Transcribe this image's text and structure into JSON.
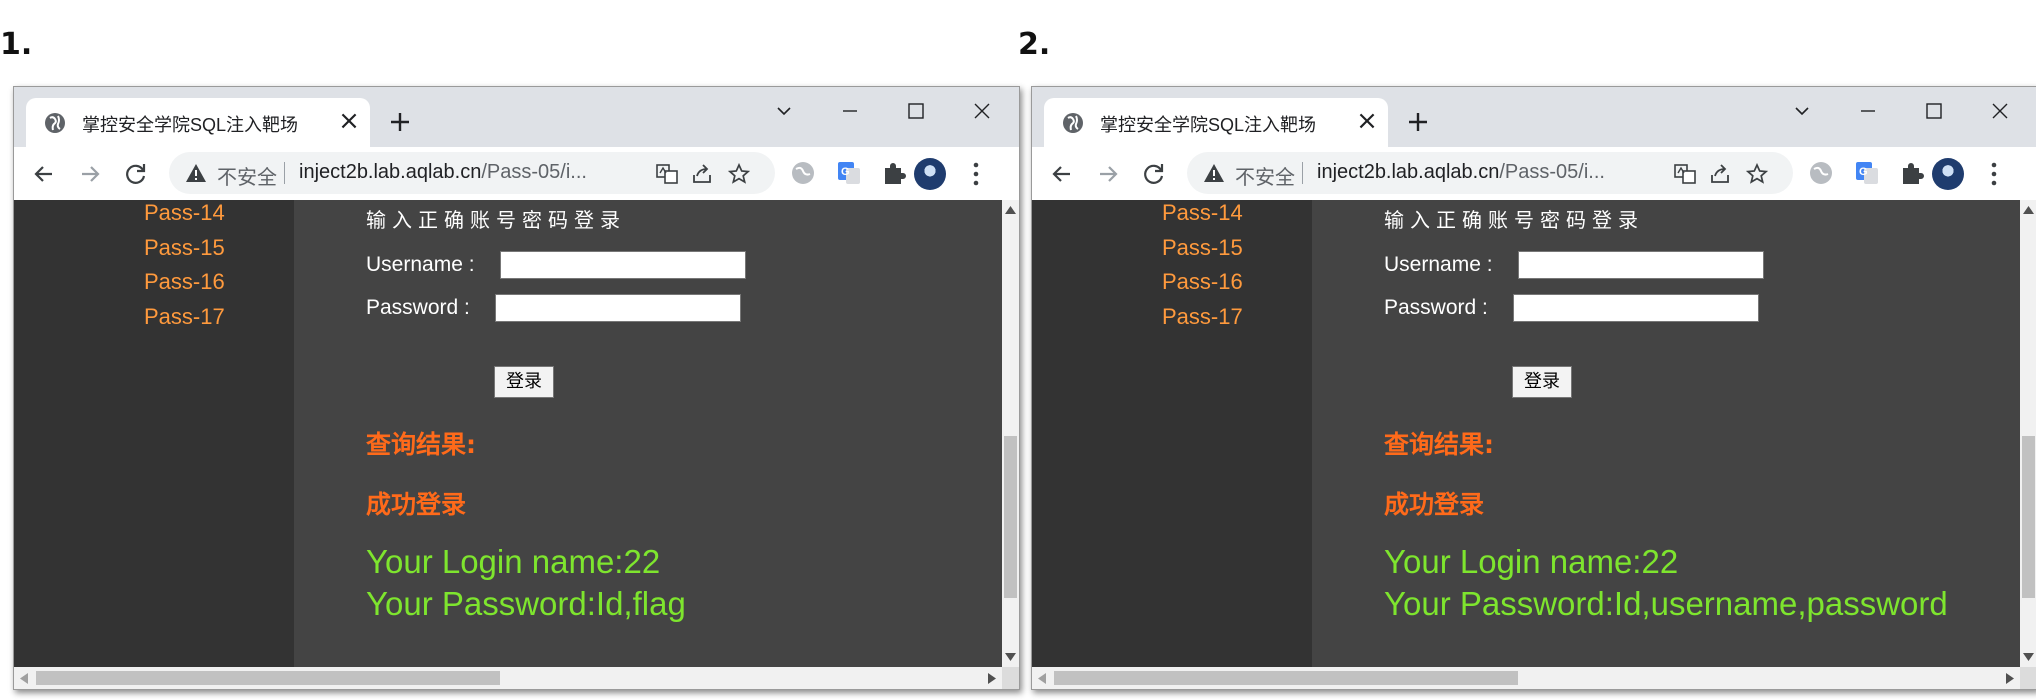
{
  "panels": [
    {
      "label": "1.",
      "tab_title": "掌控安全学院SQL注入靶场",
      "address": {
        "security_text": "不安全",
        "host": "inject2b.lab.aqlab.cn",
        "path": "/Pass-05/i..."
      },
      "sidebar_links": [
        "Pass-14",
        "Pass-15",
        "Pass-16",
        "Pass-17"
      ],
      "form": {
        "heading": "输入正确账号密码登录",
        "username_label": "Username :",
        "password_label": "Password :",
        "username_value": "",
        "password_value": "",
        "submit_label": "登录"
      },
      "results": {
        "query_label": "查询结果:",
        "status": "成功登录",
        "login_name": "Your Login name:22",
        "password": "Your Password:Id,flag"
      }
    },
    {
      "label": "2.",
      "tab_title": "掌控安全学院SQL注入靶场",
      "address": {
        "security_text": "不安全",
        "host": "inject2b.lab.aqlab.cn",
        "path": "/Pass-05/i..."
      },
      "sidebar_links": [
        "Pass-14",
        "Pass-15",
        "Pass-16",
        "Pass-17"
      ],
      "form": {
        "heading": "输入正确账号密码登录",
        "username_label": "Username :",
        "password_label": "Password :",
        "username_value": "",
        "password_value": "",
        "submit_label": "登录"
      },
      "results": {
        "query_label": "查询结果:",
        "status": "成功登录",
        "login_name": "Your Login name:22",
        "password": "Your Password:Id,username,password"
      }
    }
  ],
  "icons": {
    "tab_favicon": "globe-icon",
    "tab_close": "close-icon",
    "new_tab": "plus-icon",
    "tab_search": "chevron-down-icon",
    "minimize": "minimize-icon",
    "maximize": "maximize-icon",
    "close_window": "close-icon",
    "back": "arrow-left-icon",
    "forward": "arrow-right-icon",
    "reload": "reload-icon",
    "not_secure": "warning-triangle-icon",
    "translate": "translate-icon",
    "share": "share-icon",
    "bookmark": "star-icon",
    "extensions": "puzzle-icon",
    "profile": "avatar",
    "menu": "more-vertical-icon"
  },
  "colors": {
    "sidebar_bg": "#333333",
    "content_bg": "#444444",
    "sidebar_link": "#ff9a3d",
    "result_label": "#ff6a1a",
    "result_text": "#7ee52e",
    "chrome_frame": "#dee1e6"
  }
}
